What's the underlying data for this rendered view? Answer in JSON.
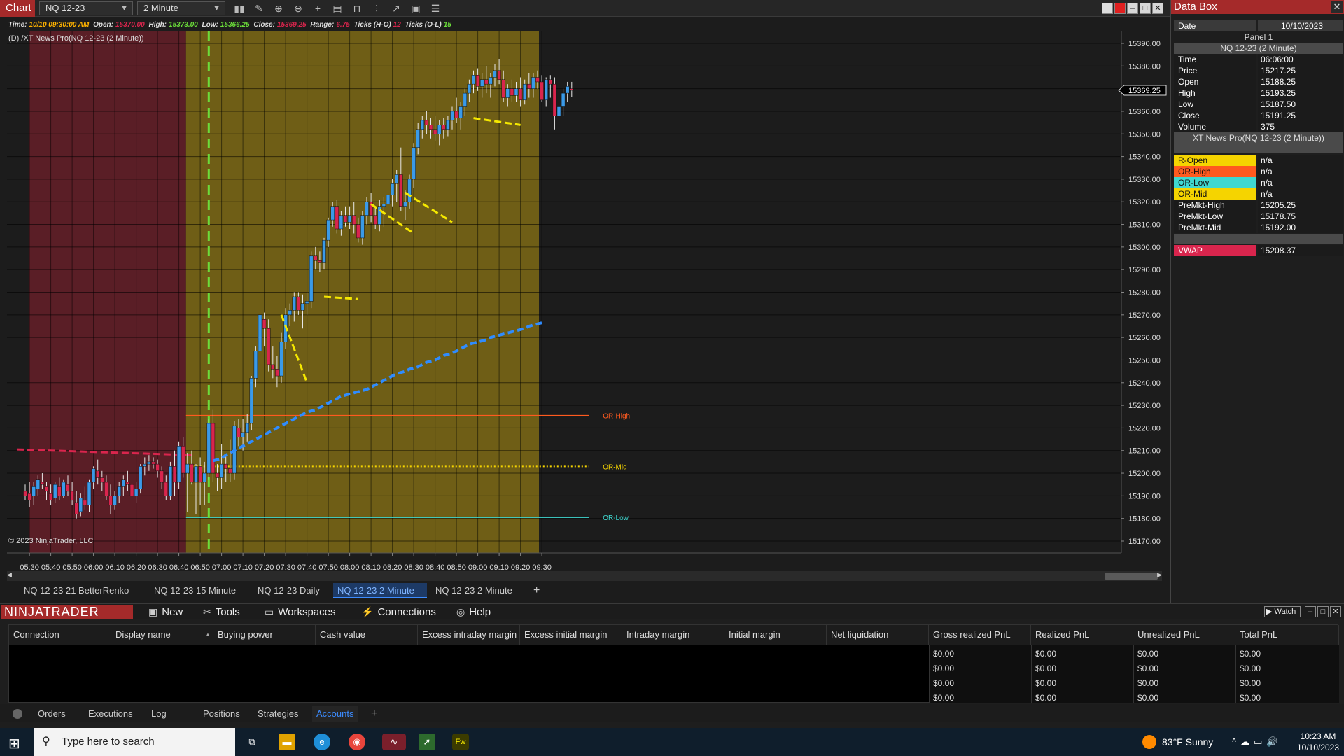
{
  "toolbar": {
    "app_tab": "Chart",
    "instrument": "NQ 12-23",
    "interval": "2 Minute"
  },
  "info_line": {
    "time_label": "Time:",
    "time_value": "10/10 09:30:00 AM",
    "open_label": "Open:",
    "open_value": "15370.00",
    "high_label": "High:",
    "high_value": "15373.00",
    "low_label": "Low:",
    "low_value": "15366.25",
    "close_label": "Close:",
    "close_value": "15369.25",
    "range_label": "Range:",
    "range_value": "6.75",
    "ticks_ho_label": "Ticks (H-O)",
    "ticks_ho_value": "12",
    "ticks_ol_label": "Ticks (O-L)",
    "ticks_ol_value": "15"
  },
  "indicator_label": "(D) /XT News Pro(NQ 12-23 (2 Minute))",
  "copyright": "© 2023 NinjaTrader, LLC",
  "colors": {
    "premarket_bg": "#5a1e26",
    "session_bg": "#6f5e16",
    "up_candle": "#3a9ae8",
    "down_candle": "#d9254d",
    "or_high": "#ff5a1f",
    "or_mid": "#f5d400",
    "or_low": "#3fd8d0",
    "vwap": "#2f8cff",
    "prev_vwap": "#d9254d",
    "trendline": "#f5e800",
    "open_marker": "#6bdc3a"
  },
  "chart_data": {
    "type": "candlestick",
    "title": "",
    "xlabel": "",
    "ylabel": "",
    "x_ticks": [
      "05:30",
      "05:40",
      "05:50",
      "06:00",
      "06:10",
      "06:20",
      "06:30",
      "06:40",
      "06:50",
      "07:00",
      "07:10",
      "07:20",
      "07:30",
      "07:40",
      "07:50",
      "08:00",
      "08:10",
      "08:20",
      "08:30",
      "08:40",
      "08:50",
      "09:00",
      "09:10",
      "09:20",
      "09:30"
    ],
    "y_ticks": [
      15170,
      15180,
      15190,
      15200,
      15210,
      15220,
      15230,
      15240,
      15250,
      15260,
      15270,
      15280,
      15290,
      15300,
      15310,
      15320,
      15330,
      15340,
      15350,
      15360,
      15370,
      15380,
      15390
    ],
    "y_format": ".2f",
    "ylim": [
      15167,
      15392
    ],
    "bar_minutes": 2,
    "start_time": "05:28",
    "ohlc": [
      [
        15192,
        15195,
        15188,
        15190
      ],
      [
        15191,
        15196,
        15185,
        15188
      ],
      [
        15190,
        15196,
        15186,
        15194
      ],
      [
        15193,
        15199,
        15190,
        15197
      ],
      [
        15196,
        15200,
        15193,
        15195
      ],
      [
        15194,
        15196,
        15188,
        15192
      ],
      [
        15191,
        15195,
        15186,
        15188
      ],
      [
        15189,
        15196,
        15187,
        15195
      ],
      [
        15194,
        15198,
        15188,
        15190
      ],
      [
        15190,
        15197,
        15189,
        15196
      ],
      [
        15195,
        15199,
        15190,
        15192
      ],
      [
        15192,
        15196,
        15186,
        15188
      ],
      [
        15187,
        15192,
        15180,
        15182
      ],
      [
        15183,
        15191,
        15181,
        15189
      ],
      [
        15188,
        15194,
        15184,
        15186
      ],
      [
        15186,
        15197,
        15183,
        15196
      ],
      [
        15196,
        15203,
        15193,
        15202
      ],
      [
        15201,
        15206,
        15195,
        15198
      ],
      [
        15198,
        15201,
        15192,
        15196
      ],
      [
        15196,
        15199,
        15188,
        15190
      ],
      [
        15190,
        15195,
        15182,
        15186
      ],
      [
        15186,
        15192,
        15184,
        15190
      ],
      [
        15190,
        15196,
        15187,
        15194
      ],
      [
        15194,
        15199,
        15190,
        15197
      ],
      [
        15196,
        15201,
        15192,
        15195
      ],
      [
        15195,
        15198,
        15188,
        15190
      ],
      [
        15190,
        15196,
        15187,
        15193
      ],
      [
        15193,
        15204,
        15191,
        15203
      ],
      [
        15203,
        15207,
        15199,
        15204
      ],
      [
        15204,
        15208,
        15201,
        15205
      ],
      [
        15205,
        15207,
        15202,
        15204
      ],
      [
        15204,
        15206,
        15198,
        15201
      ],
      [
        15201,
        15203,
        15193,
        15196
      ],
      [
        15196,
        15199,
        15188,
        15190
      ],
      [
        15190,
        15205,
        15188,
        15203
      ],
      [
        15203,
        15210,
        15190,
        15196
      ],
      [
        15196,
        15214,
        15193,
        15212
      ],
      [
        15212,
        15216,
        15198,
        15200
      ],
      [
        15200,
        15209,
        15183,
        15204
      ],
      [
        15204,
        15210,
        15195,
        15196
      ],
      [
        15196,
        15204,
        15182,
        15203
      ],
      [
        15203,
        15207,
        15186,
        15196
      ],
      [
        15196,
        15205,
        15186,
        15200
      ],
      [
        15200,
        15224,
        15197,
        15222
      ],
      [
        15222,
        15228,
        15196,
        15200
      ],
      [
        15200,
        15204,
        15192,
        15198
      ],
      [
        15198,
        15213,
        15193,
        15204
      ],
      [
        15204,
        15208,
        15196,
        15202
      ],
      [
        15202,
        15215,
        15196,
        15200
      ],
      [
        15200,
        15223,
        15197,
        15221
      ],
      [
        15220,
        15224,
        15212,
        15216
      ],
      [
        15216,
        15224,
        15210,
        15218
      ],
      [
        15218,
        15226,
        15214,
        15222
      ],
      [
        15222,
        15243,
        15219,
        15242
      ],
      [
        15242,
        15256,
        15238,
        15254
      ],
      [
        15254,
        15272,
        15252,
        15270
      ],
      [
        15268,
        15271,
        15256,
        15264
      ],
      [
        15264,
        15268,
        15245,
        15248
      ],
      [
        15248,
        15256,
        15242,
        15246
      ],
      [
        15246,
        15252,
        15238,
        15243
      ],
      [
        15243,
        15262,
        15240,
        15258
      ],
      [
        15258,
        15273,
        15255,
        15270
      ],
      [
        15270,
        15275,
        15265,
        15272
      ],
      [
        15272,
        15280,
        15267,
        15278
      ],
      [
        15278,
        15280,
        15270,
        15272
      ],
      [
        15272,
        15279,
        15264,
        15275
      ],
      [
        15275,
        15280,
        15270,
        15276
      ],
      [
        15276,
        15298,
        15273,
        15296
      ],
      [
        15296,
        15300,
        15290,
        15294
      ],
      [
        15294,
        15298,
        15289,
        15293
      ],
      [
        15293,
        15304,
        15290,
        15303
      ],
      [
        15303,
        15313,
        15300,
        15312
      ],
      [
        15312,
        15320,
        15309,
        15318
      ],
      [
        15318,
        15321,
        15306,
        15308
      ],
      [
        15308,
        15316,
        15305,
        15314
      ],
      [
        15314,
        15318,
        15309,
        15311
      ],
      [
        15311,
        15318,
        15308,
        15314
      ],
      [
        15314,
        15320,
        15306,
        15310
      ],
      [
        15310,
        15313,
        15302,
        15304
      ],
      [
        15304,
        15316,
        15301,
        15314
      ],
      [
        15314,
        15322,
        15310,
        15320
      ],
      [
        15320,
        15324,
        15311,
        15314
      ],
      [
        15314,
        15318,
        15308,
        15310
      ],
      [
        15310,
        15321,
        15307,
        15318
      ],
      [
        15318,
        15322,
        15309,
        15319
      ],
      [
        15319,
        15326,
        15314,
        15323
      ],
      [
        15323,
        15330,
        15318,
        15328
      ],
      [
        15328,
        15334,
        15320,
        15332
      ],
      [
        15332,
        15344,
        15316,
        15318
      ],
      [
        15318,
        15325,
        15312,
        15320
      ],
      [
        15320,
        15332,
        15317,
        15330
      ],
      [
        15330,
        15346,
        15326,
        15344
      ],
      [
        15344,
        15355,
        15341,
        15352
      ],
      [
        15352,
        15358,
        15348,
        15356
      ],
      [
        15356,
        15360,
        15350,
        15354
      ],
      [
        15354,
        15357,
        15348,
        15352
      ],
      [
        15352,
        15358,
        15347,
        15350
      ],
      [
        15350,
        15356,
        15345,
        15354
      ],
      [
        15354,
        15357,
        15348,
        15352
      ],
      [
        15352,
        15358,
        15349,
        15356
      ],
      [
        15356,
        15362,
        15352,
        15360
      ],
      [
        15360,
        15366,
        15355,
        15357
      ],
      [
        15357,
        15364,
        15352,
        15362
      ],
      [
        15362,
        15370,
        15358,
        15368
      ],
      [
        15368,
        15374,
        15364,
        15372
      ],
      [
        15372,
        15378,
        15368,
        15376
      ],
      [
        15376,
        15379,
        15369,
        15371
      ],
      [
        15371,
        15377,
        15366,
        15374
      ],
      [
        15374,
        15380,
        15368,
        15372
      ],
      [
        15372,
        15377,
        15366,
        15375
      ],
      [
        15375,
        15381,
        15371,
        15378
      ],
      [
        15378,
        15383,
        15372,
        15374
      ],
      [
        15374,
        15378,
        15364,
        15366
      ],
      [
        15366,
        15372,
        15362,
        15370
      ],
      [
        15370,
        15374,
        15364,
        15367
      ],
      [
        15367,
        15373,
        15364,
        15370
      ],
      [
        15370,
        15375,
        15362,
        15365
      ],
      [
        15365,
        15374,
        15363,
        15372
      ],
      [
        15372,
        15377,
        15366,
        15370
      ],
      [
        15370,
        15377,
        15366,
        15375
      ],
      [
        15375,
        15378,
        15370,
        15373
      ],
      [
        15373,
        15376,
        15364,
        15365
      ],
      [
        15365,
        15375,
        15362,
        15374
      ],
      [
        15374,
        15376,
        15366,
        15372
      ],
      [
        15372,
        15375,
        15352,
        15358
      ],
      [
        15358,
        15363,
        15350,
        15362
      ],
      [
        15362,
        15370,
        15358,
        15368
      ],
      [
        15368,
        15373,
        15364,
        15371
      ],
      [
        15370,
        15373,
        15366.25,
        15369.25
      ]
    ],
    "session_start_index": 38,
    "session_end_index": 120,
    "opening_range_marker_index": 43,
    "levels": [
      {
        "name": "OR-High",
        "value": 15225.5
      },
      {
        "name": "OR-Mid",
        "value": 15203
      },
      {
        "name": "OR-Low",
        "value": 15180.5
      }
    ],
    "vwap": {
      "start_index": 44,
      "values": [
        15205.5,
        15206,
        15206.5,
        15208,
        15209,
        15210,
        15211,
        15212,
        15213,
        15214,
        15215,
        15216,
        15217,
        15218,
        15219,
        15220,
        15221,
        15222,
        15223,
        15224,
        15225,
        15226,
        15227,
        15227.5,
        15228,
        15229,
        15230,
        15231,
        15232,
        15233,
        15234,
        15234.5,
        15235,
        15235.5,
        15236,
        15236.5,
        15237,
        15238,
        15239,
        15240,
        15241,
        15242,
        15243,
        15244,
        15244.5,
        15245,
        15246,
        15246.5,
        15247,
        15248,
        15249,
        15249.5,
        15250,
        15251,
        15252,
        15252.5,
        15253,
        15254,
        15255,
        15256,
        15257,
        15257.5,
        15258,
        15258.5,
        15259,
        15260,
        15260.5,
        15261,
        15261.5,
        15262,
        15262.5,
        15263,
        15263.5,
        15264,
        15265,
        15265.5,
        15266,
        15266.5
      ]
    },
    "prev_vwap": {
      "start_index": 0,
      "end_index": 39,
      "from": 15210.5,
      "to": 15208
    },
    "trendlines": [
      {
        "i1": 60,
        "v1": 15270,
        "i2": 66,
        "v2": 15240
      },
      {
        "i1": 70,
        "v1": 15278,
        "i2": 78,
        "v2": 15277
      },
      {
        "i1": 81,
        "v1": 15319,
        "i2": 91,
        "v2": 15306
      },
      {
        "i1": 89,
        "v1": 15324,
        "i2": 100,
        "v2": 15311
      },
      {
        "i1": 105,
        "v1": 15357,
        "i2": 116,
        "v2": 15354
      }
    ],
    "last_price": "15369.25"
  },
  "chart_tabs": [
    "NQ 12-23 21 BetterRenko",
    "NQ 12-23 15 Minute",
    "NQ 12-23 Daily",
    "NQ 12-23 2 Minute",
    "NQ 12-23 2 Minute"
  ],
  "chart_tabs_active": 3,
  "databox": {
    "title": "Data Box",
    "date_label": "Date",
    "date_value": "10/10/2023",
    "panel": "Panel 1",
    "series_header": "NQ 12-23 (2 Minute)",
    "rows": [
      {
        "k": "Time",
        "v": "06:06:00"
      },
      {
        "k": "Price",
        "v": "15217.25"
      },
      {
        "k": "Open",
        "v": "15188.25"
      },
      {
        "k": "High",
        "v": "15193.25"
      },
      {
        "k": "Low",
        "v": "15187.50"
      },
      {
        "k": "Close",
        "v": "15191.25"
      },
      {
        "k": "Volume",
        "v": "375"
      }
    ],
    "indicator_header": "XT News Pro(NQ 12-23 (2 Minute))",
    "levels": [
      {
        "k": "R-Open",
        "v": "n/a",
        "color": "#f5d400"
      },
      {
        "k": "OR-High",
        "v": "n/a",
        "color": "#ff5a1f"
      },
      {
        "k": "OR-Low",
        "v": "n/a",
        "color": "#3fd8d0"
      },
      {
        "k": "OR-Mid",
        "v": "n/a",
        "color": "#f5d400"
      },
      {
        "k": "PreMkt-High",
        "v": "15205.25",
        "color": "#1b1b1b"
      },
      {
        "k": "PreMkt-Low",
        "v": "15178.75",
        "color": "#1b1b1b"
      },
      {
        "k": "PreMkt-Mid",
        "v": "15192.00",
        "color": "#1b1b1b"
      }
    ],
    "vwap_label": "VWAP",
    "vwap_value": "15208.37",
    "vwap_color": "#d9254d"
  },
  "control_center": {
    "logo": "NINJATRADER",
    "menu": [
      "New",
      "Tools",
      "Workspaces",
      "Connections",
      "Help"
    ],
    "watch": "Watch",
    "columns": [
      "Connection",
      "Display name",
      "Buying power",
      "Cash value",
      "Excess intraday margin",
      "Excess initial margin",
      "Intraday margin",
      "Initial margin",
      "Net liquidation",
      "Gross realized PnL",
      "Realized PnL",
      "Unrealized PnL",
      "Total PnL"
    ],
    "rows": [
      [
        "$0.00",
        "$0.00",
        "$0.00",
        "$0.00"
      ],
      [
        "$0.00",
        "$0.00",
        "$0.00",
        "$0.00"
      ],
      [
        "$0.00",
        "$0.00",
        "$0.00",
        "$0.00"
      ],
      [
        "$0.00",
        "$0.00",
        "$0.00",
        "$0.00"
      ]
    ],
    "tabs": [
      "Orders",
      "Executions",
      "Log",
      "Positions",
      "Strategies",
      "Accounts"
    ],
    "active_tab": 5
  },
  "taskbar": {
    "search_placeholder": "Type here to search",
    "weather": "83°F  Sunny",
    "time": "10:23 AM",
    "date": "10/10/2023"
  }
}
